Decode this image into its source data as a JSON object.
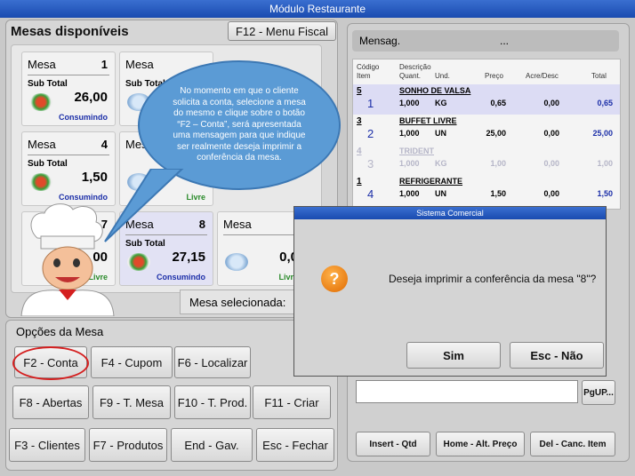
{
  "window": {
    "title": "Módulo Restaurante"
  },
  "left": {
    "title": "Mesas disponíveis",
    "menu_fiscal": "F12 - Menu Fiscal",
    "mesa_label": "Mesa",
    "subtotal_label": "Sub Total",
    "selected_label": "Mesa selecionada:",
    "tables": [
      {
        "num": "1",
        "value": "26,00",
        "status": "Consumindo"
      },
      {
        "num": "",
        "value": "",
        "status": ""
      },
      {
        "num": "4",
        "value": "1,50",
        "status": "Consumindo"
      },
      {
        "num": "",
        "value": "",
        "status": "Livre"
      },
      {
        "num": "7",
        "value": "00",
        "status": "Livre"
      },
      {
        "num": "8",
        "value": "27,15",
        "status": "Consumindo"
      },
      {
        "num": "",
        "value": "0,0",
        "status": "Livre"
      }
    ]
  },
  "options": {
    "title": "Opções da Mesa",
    "buttons": [
      "F2 - Conta",
      "F4 - Cupom",
      "F6 - Localizar",
      "F8 - Abertas",
      "F9 - T. Mesa",
      "F10 - T. Prod.",
      "F11 - Criar",
      "F3 - Clientes",
      "F7 - Produtos",
      "End - Gav.",
      "Esc - Fechar"
    ]
  },
  "right": {
    "message_label": "Mensag.",
    "message_value": "...",
    "headers": {
      "codigo": "Código",
      "item": "Item",
      "descricao": "Descrição",
      "quant": "Quant.",
      "und": "Und.",
      "preco": "Preço",
      "acre": "Acre/Desc",
      "total": "Total"
    },
    "rows": [
      {
        "code": "5",
        "desc": "SONHO DE VALSA",
        "item": "1",
        "qt": "1,000",
        "un": "KG",
        "price": "0,65",
        "ad": "0,00",
        "total": "0,65"
      },
      {
        "code": "3",
        "desc": "BUFFET LIVRE",
        "item": "2",
        "qt": "1,000",
        "un": "UN",
        "price": "25,00",
        "ad": "0,00",
        "total": "25,00"
      },
      {
        "code": "4",
        "desc": "TRIDENT",
        "item": "3",
        "qt": "1,000",
        "un": "KG",
        "price": "1,00",
        "ad": "0,00",
        "total": "1,00"
      },
      {
        "code": "1",
        "desc": "REFRIGERANTE",
        "item": "4",
        "qt": "1,000",
        "un": "UN",
        "price": "1,50",
        "ad": "0,00",
        "total": "1,50"
      }
    ],
    "pgup": "PgUP...",
    "insert": "Insert - Qtd",
    "home": "Home - Alt. Preço",
    "del": "Del - Canc. Item"
  },
  "dialog": {
    "title": "Sistema Comercial",
    "icon": "question-icon",
    "message": "Deseja imprimir a conferência da mesa \"8\"?",
    "yes": "Sim",
    "no": "Esc - Não"
  },
  "bubble": {
    "text": "No momento em que o cliente solicita a conta, selecione a mesa do mesmo e clique sobre o botão “F2 – Conta”, será apresentada uma mensagem para que indique ser realmente deseja imprimir a conferência da mesa."
  }
}
